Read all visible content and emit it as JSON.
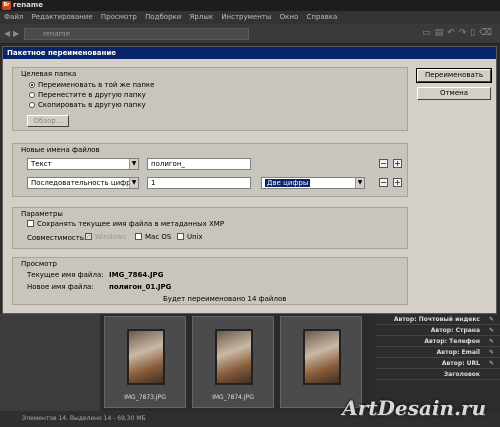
{
  "app": {
    "title": "rename",
    "logo": "Br"
  },
  "menu": [
    "Файл",
    "Редактирование",
    "Просмотр",
    "Подборки",
    "Ярлык",
    "Инструменты",
    "Окно",
    "Справка"
  ],
  "toolbar": {
    "path": "rename"
  },
  "dialog": {
    "title": "Пакетное переименование",
    "rename_button": "Переименовать",
    "cancel_button": "Отмена",
    "target": {
      "title": "Целевая папка",
      "options": [
        "Переименовать в той же папке",
        "Перенестите в другую папку",
        "Скопировать в другую папку"
      ],
      "selected": 0,
      "browse": "Обзор..."
    },
    "names": {
      "title": "Новые имена файлов",
      "row1": {
        "type": "Текст",
        "value": "полигон_"
      },
      "row2": {
        "type": "Последовательность цифр",
        "value": "1",
        "digits": "Две цифры"
      }
    },
    "options": {
      "title": "Параметры",
      "keep_name": "Сохранять текущее имя файла в метаданных XMP",
      "compat_label": "Совместимость:",
      "windows": "Windows",
      "macos": "Mac OS",
      "unix": "Unix"
    },
    "preview": {
      "title": "Просмотр",
      "current_label": "Текущее имя файла:",
      "current_value": "IMG_7864.JPG",
      "new_label": "Новое имя файла:",
      "new_value": "полигон_01.JPG",
      "summary": "Будет переименовано 14 файлов"
    }
  },
  "thumbs": [
    "IMG_7873.JPG",
    "IMG_7874.JPG",
    ""
  ],
  "props": [
    "Автор: Почтовый индекс",
    "Автор: Страна",
    "Автор: Телефон",
    "Автор: Email",
    "Автор: URL",
    "Заголовок"
  ],
  "status": "Элементов 14, Выделено 14 - 69,30 МБ",
  "watermark": "ArtDesain.ru"
}
